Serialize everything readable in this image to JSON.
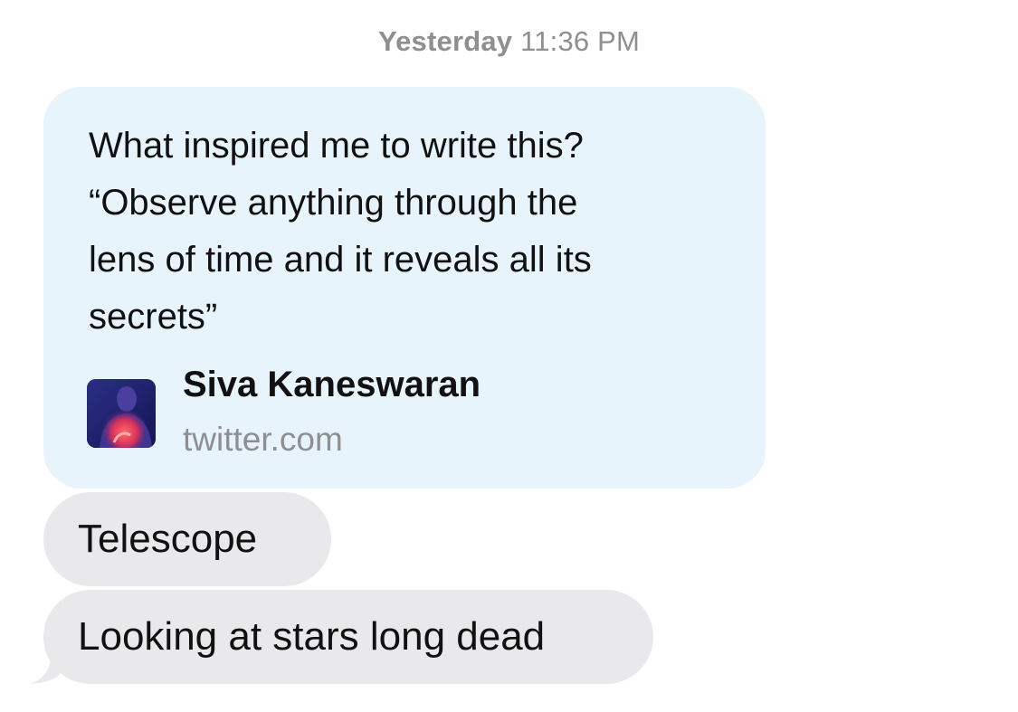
{
  "timestamp": {
    "day": "Yesterday",
    "time": "11:36 PM"
  },
  "link_preview": {
    "text": "What inspired me to write this?\n“Observe anything through the\nlens of time and it reveals all its\nsecrets”",
    "title": "Siva Kaneswaran",
    "domain": "twitter.com",
    "avatar_icon": "profile-photo"
  },
  "messages": [
    {
      "text": "Telescope"
    },
    {
      "text": "Looking at stars long dead"
    }
  ],
  "colors": {
    "link_bubble_bg": "#e8f4fc",
    "received_bubble_bg": "#e9e9eb",
    "timestamp_text": "#8e8e93"
  }
}
